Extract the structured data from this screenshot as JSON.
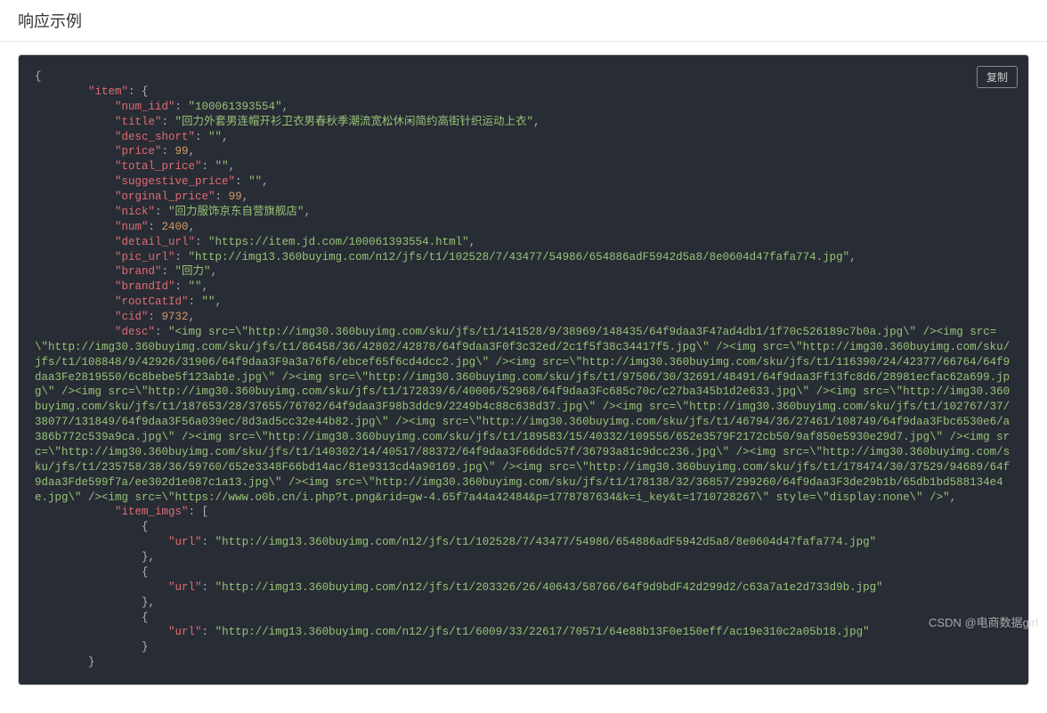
{
  "header": {
    "title": "响应示例"
  },
  "copy_label": "复制",
  "watermark": "CSDN @电商数据girl",
  "code": {
    "item": {
      "num_iid": "100061393554",
      "title": "回力外套男连帽开衫卫衣男春秋季潮流宽松休闲简约高街针织运动上衣",
      "desc_short": "",
      "price": 99,
      "total_price": "",
      "suggestive_price": "",
      "orginal_price": 99,
      "nick": "回力服饰京东自营旗舰店",
      "num": 2400,
      "detail_url": "https://item.jd.com/100061393554.html",
      "pic_url": "http://img13.360buyimg.com/n12/jfs/t1/102528/7/43477/54986/654886adF5942d5a8/8e0604d47fafa774.jpg",
      "brand": "回力",
      "brandId": "",
      "rootCatId": "",
      "cid": 9732,
      "desc": "<img src=\\\"http://img30.360buyimg.com/sku/jfs/t1/141528/9/38969/148435/64f9daa3F47ad4db1/1f70c526189c7b0a.jpg\\\" /><img src=\\\"http://img30.360buyimg.com/sku/jfs/t1/86458/36/42802/42878/64f9daa3F0f3c32ed/2c1f5f38c34417f5.jpg\\\" /><img src=\\\"http://img30.360buyimg.com/sku/jfs/t1/108848/9/42926/31906/64f9daa3F9a3a76f6/ebcef65f6cd4dcc2.jpg\\\" /><img src=\\\"http://img30.360buyimg.com/sku/jfs/t1/116390/24/42377/66764/64f9daa3Fe2819550/6c8bebe5f123ab1e.jpg\\\" /><img src=\\\"http://img30.360buyimg.com/sku/jfs/t1/97506/30/32691/48491/64f9daa3Ff13fc8d6/28981ecfac62a699.jpg\\\" /><img src=\\\"http://img30.360buyimg.com/sku/jfs/t1/172839/6/40006/52968/64f9daa3Fc685c70c/c27ba345b1d2e633.jpg\\\" /><img src=\\\"http://img30.360buyimg.com/sku/jfs/t1/187653/28/37655/76702/64f9daa3F98b3ddc9/2249b4c88c638d37.jpg\\\" /><img src=\\\"http://img30.360buyimg.com/sku/jfs/t1/102767/37/38077/131849/64f9daa3F56a039ec/8d3ad5cc32e44b82.jpg\\\" /><img src=\\\"http://img30.360buyimg.com/sku/jfs/t1/46794/36/27461/108749/64f9daa3Fbc6530e6/a386b772c539a9ca.jpg\\\" /><img src=\\\"http://img30.360buyimg.com/sku/jfs/t1/189583/15/40332/109556/652e3579F2172cb50/9af850e5930e29d7.jpg\\\" /><img src=\\\"http://img30.360buyimg.com/sku/jfs/t1/140302/14/40517/88372/64f9daa3F66ddc57f/36793a81c9dcc236.jpg\\\" /><img src=\\\"http://img30.360buyimg.com/sku/jfs/t1/235758/38/36/59760/652e3348F66bd14ac/81e9313cd4a90169.jpg\\\" /><img src=\\\"http://img30.360buyimg.com/sku/jfs/t1/178474/30/37529/94689/64f9daa3Fde599f7a/ee302d1e087c1a13.jpg\\\" /><img src=\\\"http://img30.360buyimg.com/sku/jfs/t1/178138/32/36857/299260/64f9daa3F3de29b1b/65db1bd588134e4e.jpg\\\" /><img src=\\\"https://www.o0b.cn/i.php?t.png&rid=gw-4.65f7a44a42484&p=1778787634&k=i_key&t=1710728267\\\" style=\\\"display:none\\\" />",
      "item_imgs": [
        {
          "url": "http://img13.360buyimg.com/n12/jfs/t1/102528/7/43477/54986/654886adF5942d5a8/8e0604d47fafa774.jpg"
        },
        {
          "url": "http://img13.360buyimg.com/n12/jfs/t1/203326/26/40643/58766/64f9d9bdF42d299d2/c63a7a1e2d733d9b.jpg"
        },
        {
          "url": "http://img13.360buyimg.com/n12/jfs/t1/6009/33/22617/70571/64e88b13F0e150eff/ac19e310c2a05b18.jpg"
        }
      ]
    }
  }
}
